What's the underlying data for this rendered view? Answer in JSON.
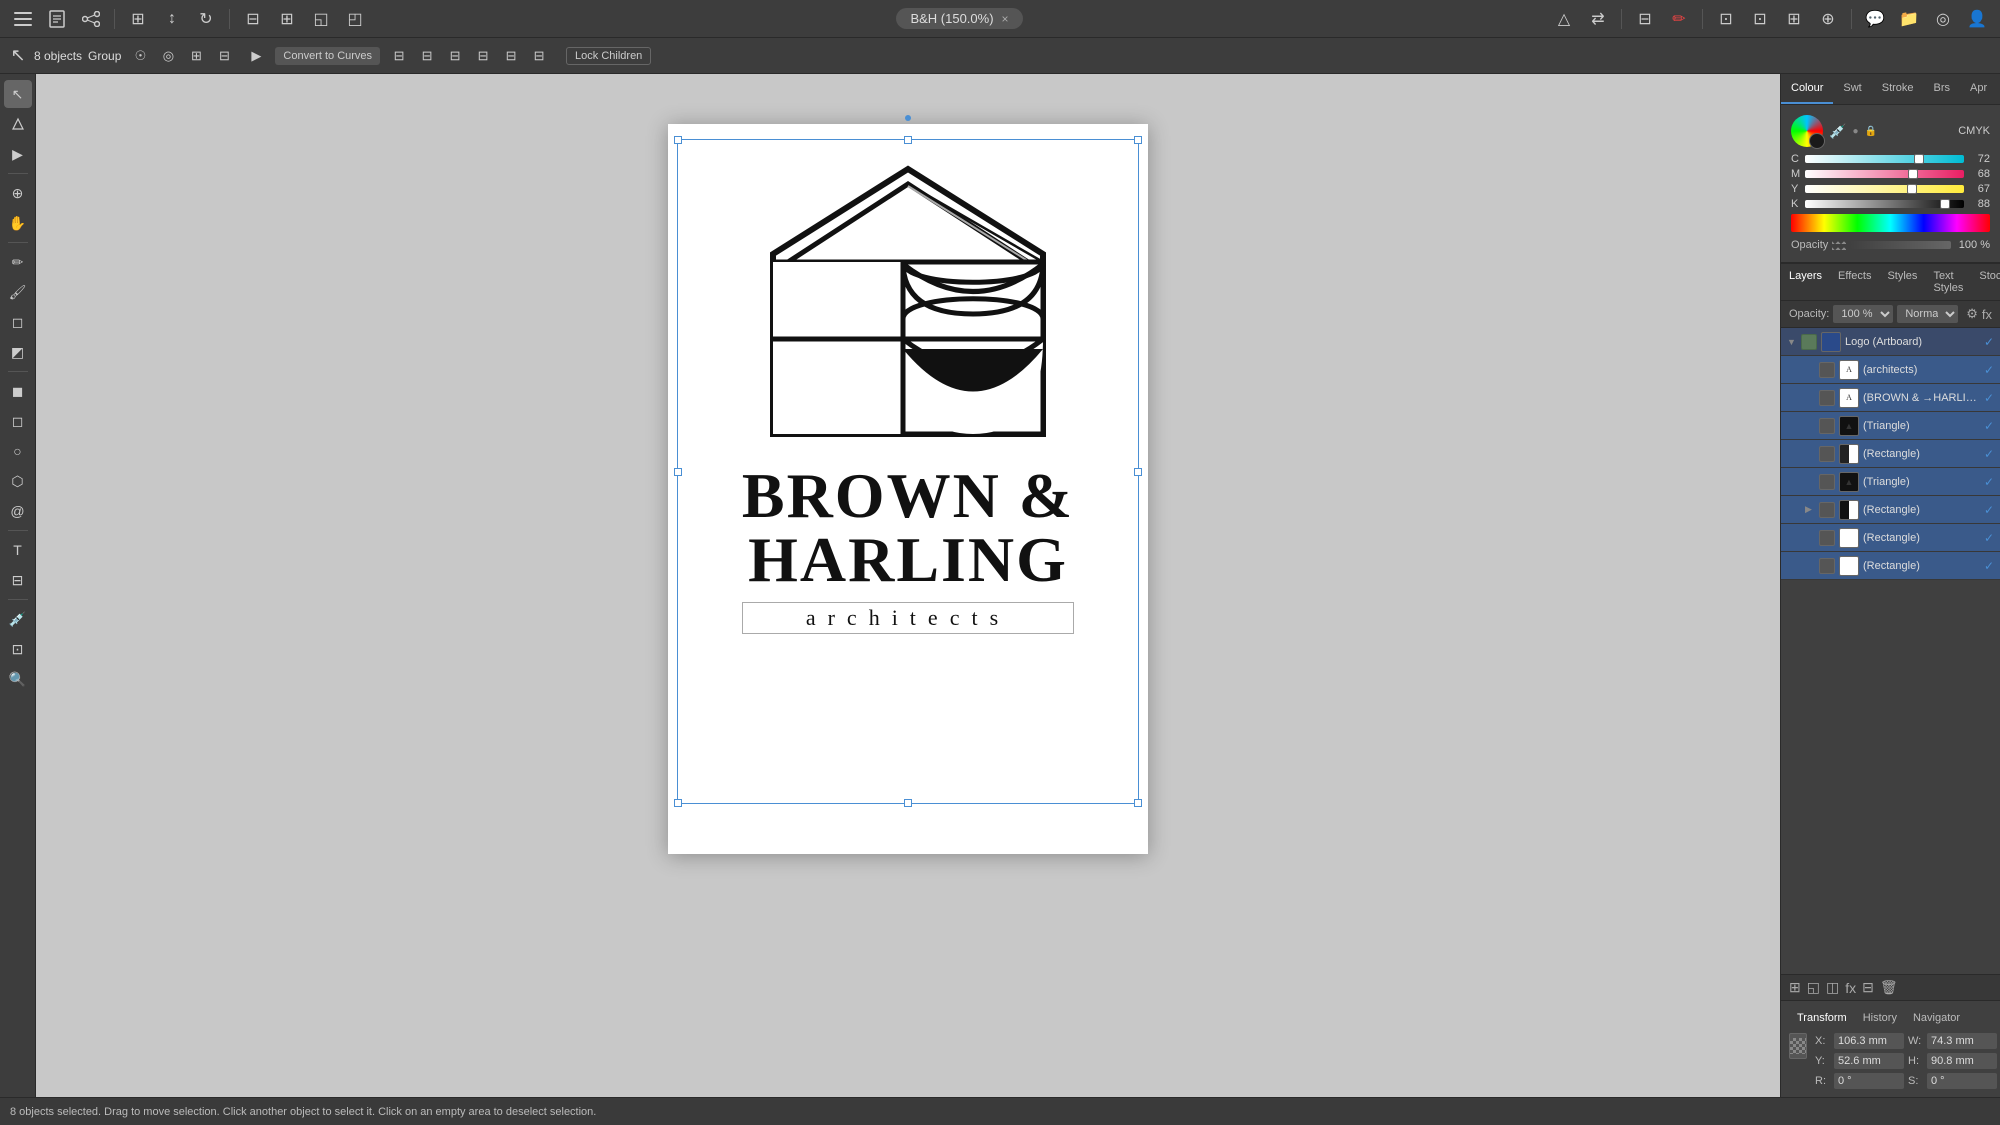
{
  "app": {
    "title": "B&H (150.0%)",
    "close_label": "×"
  },
  "top_toolbar": {
    "icons": [
      "🎨",
      "⚙️",
      "📐",
      "✏️",
      "🔧",
      "📋",
      "📄",
      "📋",
      "📤"
    ]
  },
  "second_toolbar": {
    "objects_count": "8 objects",
    "group_label": "Group",
    "convert_btn": "Convert to Curves",
    "lock_children_btn": "Lock Children"
  },
  "right_tabs": [
    {
      "label": "Colour",
      "active": true
    },
    {
      "label": "Swt",
      "active": false
    },
    {
      "label": "Stroke",
      "active": false
    },
    {
      "label": "Brs",
      "active": false
    },
    {
      "label": "Apr",
      "active": false
    }
  ],
  "color": {
    "mode": "CMYK",
    "c": {
      "value": 72,
      "pct": 0.72
    },
    "m": {
      "value": 68,
      "pct": 0.68
    },
    "y": {
      "value": 67,
      "pct": 0.67
    },
    "k": {
      "value": 88,
      "pct": 0.88
    },
    "opacity_label": "Opacity",
    "opacity_value": "100 %"
  },
  "layers": {
    "tab_label": "Layers",
    "tabs": [
      {
        "label": "Layers",
        "active": true
      },
      {
        "label": "Effects"
      },
      {
        "label": "Styles"
      },
      {
        "label": "Text Styles"
      },
      {
        "label": "Stock"
      }
    ],
    "opacity_label": "Opacity:",
    "opacity_value": "100 %",
    "blend_mode": "Normal",
    "items": [
      {
        "name": "Logo (Artboard)",
        "type": "artboard",
        "indent": 0,
        "visible": true,
        "checked": true,
        "expanded": true
      },
      {
        "name": "(architects)",
        "type": "text",
        "indent": 1,
        "visible": true,
        "checked": true
      },
      {
        "name": "(BROWN & →HARLING)",
        "type": "text",
        "indent": 1,
        "visible": true,
        "checked": true
      },
      {
        "name": "(Triangle)",
        "type": "shape-dark",
        "indent": 1,
        "visible": true,
        "checked": true
      },
      {
        "name": "(Rectangle)",
        "type": "shape-half",
        "indent": 1,
        "visible": true,
        "checked": true
      },
      {
        "name": "(Triangle)",
        "type": "shape-dark",
        "indent": 1,
        "visible": true,
        "checked": true
      },
      {
        "name": "(Rectangle)",
        "type": "shape-half2",
        "indent": 1,
        "visible": true,
        "checked": true
      },
      {
        "name": "(Rectangle)",
        "type": "shape-white",
        "indent": 1,
        "visible": true,
        "checked": true
      },
      {
        "name": "(Rectangle)",
        "type": "shape-white",
        "indent": 1,
        "visible": true,
        "checked": true
      }
    ]
  },
  "transform": {
    "tabs": [
      "Transform",
      "History",
      "Navigator"
    ],
    "active_tab": "Transform",
    "x": {
      "label": "X:",
      "value": "106.3 mm"
    },
    "y": {
      "label": "Y:",
      "value": "52.6 mm"
    },
    "w": {
      "label": "W:",
      "value": "74.3 mm"
    },
    "h": {
      "label": "H:",
      "value": "90.8 mm"
    },
    "r": {
      "label": "R:",
      "value": "0 °"
    },
    "s": {
      "label": "S:",
      "value": "0 °"
    }
  },
  "status_bar": {
    "text": "8 objects selected.  Drag to move selection.  Click another object to select it.  Click on an empty area to deselect selection."
  },
  "canvas": {
    "artboard_label": "Logo",
    "logo_line1": "BROWN &",
    "logo_line2": "HARLING",
    "logo_sub": "architects"
  }
}
